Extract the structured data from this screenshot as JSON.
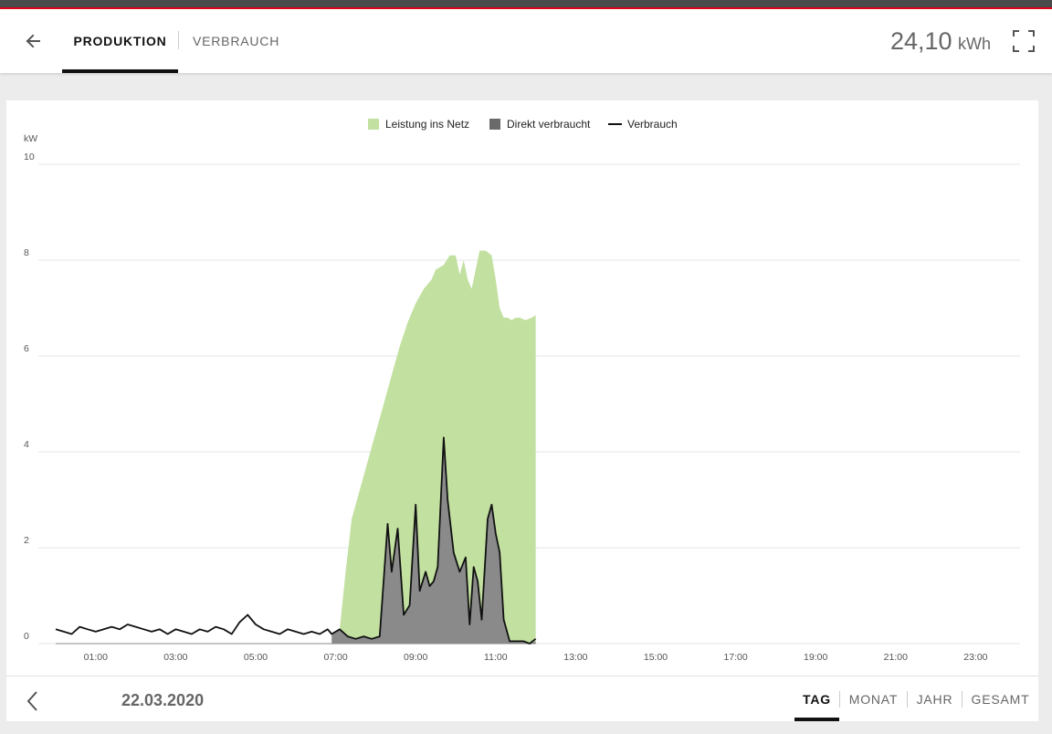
{
  "header": {
    "tabs": [
      "PRODUKTION",
      "VERBRAUCH"
    ],
    "total_value": "24,10",
    "total_unit": "kWh",
    "back_icon": "arrow-left-icon",
    "fullscreen_icon": "fullscreen-icon"
  },
  "footer": {
    "date": "22.03.2020",
    "periods": [
      "TAG",
      "MONAT",
      "JAHR",
      "GESAMT"
    ],
    "prev_icon": "chevron-left-icon"
  },
  "colors": {
    "grid_feed": "#c2e0a0",
    "direct": "#8a8a8a",
    "consumption": "#111111",
    "accent": "#e2001a"
  },
  "chart_data": {
    "type": "area",
    "ylabel": "kW",
    "ylim": [
      0,
      10
    ],
    "yticks": [
      0,
      2,
      4,
      6,
      8,
      10
    ],
    "xlim": [
      0,
      24
    ],
    "xticks": [
      "01:00",
      "03:00",
      "05:00",
      "07:00",
      "09:00",
      "11:00",
      "13:00",
      "15:00",
      "17:00",
      "19:00",
      "21:00",
      "23:00"
    ],
    "legend": [
      "Leistung ins Netz",
      "Direkt verbraucht",
      "Verbrauch"
    ],
    "series": [
      {
        "name": "Leistung ins Netz",
        "x": [
          6.9,
          7.1,
          7.25,
          7.4,
          7.6,
          7.8,
          8.0,
          8.2,
          8.4,
          8.6,
          8.8,
          9.0,
          9.2,
          9.4,
          9.5,
          9.7,
          9.85,
          10.0,
          10.1,
          10.2,
          10.3,
          10.4,
          10.5,
          10.6,
          10.75,
          10.9,
          11.0,
          11.1,
          11.2,
          11.3,
          11.4,
          11.5,
          11.6,
          11.75,
          11.9,
          12.0
        ],
        "values": [
          0,
          0.3,
          1.5,
          2.6,
          3.2,
          3.8,
          4.4,
          5.0,
          5.6,
          6.2,
          6.7,
          7.1,
          7.4,
          7.6,
          7.8,
          7.9,
          8.1,
          8.1,
          7.7,
          8.0,
          7.6,
          7.4,
          7.8,
          8.2,
          8.2,
          8.1,
          7.6,
          7.0,
          6.8,
          6.8,
          6.75,
          6.8,
          6.8,
          6.75,
          6.8,
          6.85
        ]
      },
      {
        "name": "Direkt verbraucht",
        "x": [
          6.9,
          7.1,
          7.3,
          7.5,
          7.7,
          7.9,
          8.1,
          8.3,
          8.4,
          8.55,
          8.7,
          8.85,
          9.0,
          9.1,
          9.25,
          9.35,
          9.45,
          9.55,
          9.7,
          9.8,
          9.95,
          10.1,
          10.25,
          10.35,
          10.45,
          10.55,
          10.65,
          10.8,
          10.9,
          11.0,
          11.1,
          11.2,
          11.35,
          11.5,
          11.7,
          11.85,
          12.0
        ],
        "values": [
          0.2,
          0.3,
          0.15,
          0.1,
          0.15,
          0.1,
          0.15,
          2.5,
          1.5,
          2.4,
          0.6,
          0.8,
          2.9,
          1.1,
          1.5,
          1.2,
          1.3,
          1.6,
          4.3,
          3.0,
          1.9,
          1.5,
          1.8,
          0.4,
          1.6,
          1.3,
          0.5,
          2.6,
          2.9,
          2.3,
          1.9,
          0.5,
          0.05,
          0.05,
          0.05,
          0.0,
          0.05
        ]
      },
      {
        "name": "Verbrauch",
        "x": [
          0.0,
          0.2,
          0.4,
          0.6,
          0.8,
          1.0,
          1.2,
          1.4,
          1.6,
          1.8,
          2.0,
          2.2,
          2.4,
          2.6,
          2.8,
          3.0,
          3.2,
          3.4,
          3.6,
          3.8,
          4.0,
          4.2,
          4.4,
          4.6,
          4.8,
          5.0,
          5.2,
          5.4,
          5.6,
          5.8,
          6.0,
          6.2,
          6.4,
          6.6,
          6.8,
          6.9,
          7.1,
          7.3,
          7.5,
          7.7,
          7.9,
          8.1,
          8.3,
          8.4,
          8.55,
          8.7,
          8.85,
          9.0,
          9.1,
          9.25,
          9.35,
          9.45,
          9.55,
          9.7,
          9.8,
          9.95,
          10.1,
          10.25,
          10.35,
          10.45,
          10.55,
          10.65,
          10.8,
          10.9,
          11.0,
          11.1,
          11.2,
          11.35,
          11.5,
          11.7,
          11.85,
          12.0
        ],
        "values": [
          0.3,
          0.25,
          0.2,
          0.35,
          0.3,
          0.25,
          0.3,
          0.35,
          0.3,
          0.4,
          0.35,
          0.3,
          0.25,
          0.3,
          0.2,
          0.3,
          0.25,
          0.2,
          0.3,
          0.25,
          0.35,
          0.3,
          0.2,
          0.45,
          0.6,
          0.4,
          0.3,
          0.25,
          0.2,
          0.3,
          0.25,
          0.2,
          0.25,
          0.2,
          0.3,
          0.2,
          0.3,
          0.15,
          0.1,
          0.15,
          0.1,
          0.15,
          2.5,
          1.5,
          2.4,
          0.6,
          0.8,
          2.9,
          1.1,
          1.5,
          1.2,
          1.3,
          1.6,
          4.3,
          3.0,
          1.9,
          1.5,
          1.8,
          0.4,
          1.6,
          1.3,
          0.5,
          2.6,
          2.9,
          2.3,
          1.9,
          0.5,
          0.05,
          0.05,
          0.05,
          0.0,
          0.1
        ]
      }
    ]
  }
}
